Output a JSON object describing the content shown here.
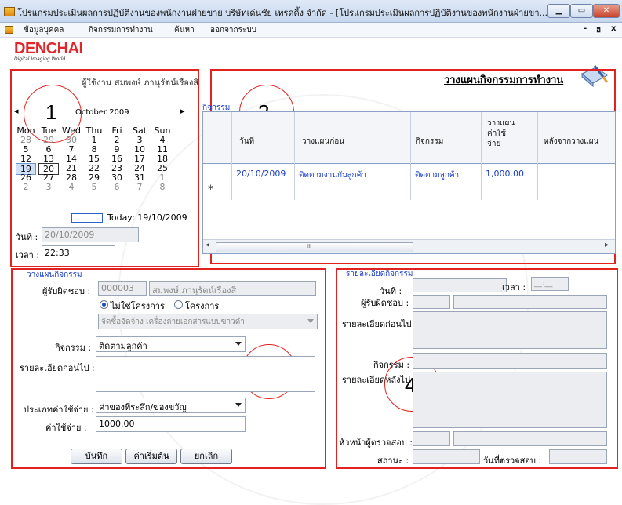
{
  "window": {
    "title": "โปรแกรมประเมินผลการปฏิบัติงานของพนักงานฝ่ายขาย บริษัทเด่นชัย เทรดดิ้ง จำกัด - [โปรแกรมประเมินผลการปฏิบัติงานของพนักงานฝ่ายขา..."
  },
  "menu": {
    "items": [
      "ข้อมูลบุคคล",
      "กิจกรรมการทำงาน",
      "ค้นหา",
      "ออกจากระบบ"
    ],
    "controls": [
      "-",
      "ฮ",
      "x"
    ]
  },
  "header": {
    "logo": "DENCHAI",
    "logo_sub": "Digital Imaging World",
    "user_label": "ผู้ใช้งาน",
    "user_name": "สมพงษ์ ภานุรัตน์เรืองสิ",
    "heading": "วางแผนกิจกรรมการทำงาน"
  },
  "annotations": [
    "1",
    "2",
    "3",
    "4"
  ],
  "calendar": {
    "prev": "◂",
    "next": "▸",
    "month": "October 2009",
    "weekdays": [
      "Mon",
      "Tue",
      "Wed",
      "Thu",
      "Fri",
      "Sat",
      "Sun"
    ],
    "weeks": [
      [
        "28",
        "29",
        "30",
        "1",
        "2",
        "3",
        "4"
      ],
      [
        "5",
        "6",
        "7",
        "8",
        "9",
        "10",
        "11"
      ],
      [
        "12",
        "13",
        "14",
        "15",
        "16",
        "17",
        "18"
      ],
      [
        "19",
        "20",
        "21",
        "22",
        "23",
        "24",
        "25"
      ],
      [
        "26",
        "27",
        "28",
        "29",
        "30",
        "31",
        "1"
      ],
      [
        "2",
        "3",
        "4",
        "5",
        "6",
        "7",
        "8"
      ]
    ],
    "today": "Today: 19/10/2009",
    "date_label": "วันที่ :",
    "date_value": "20/10/2009",
    "time_label": "เวลา :",
    "time_value": "22:33"
  },
  "activity": {
    "group_label": "กิจกรรม",
    "columns": [
      "วันที่",
      "วางแผนก่อน",
      "กิจกรรม",
      "วางแผนค่าใช้จ่าย",
      "หลังจากวางแผน"
    ],
    "rows": [
      [
        "20/10/2009",
        "ติดตามงานกับลูกค้า",
        "ติดตามลูกค้า",
        "1,000.00",
        ""
      ]
    ],
    "new_row_marker": "*",
    "scroll_left": "◂",
    "scroll_right": "▸",
    "scroll_grip": "III"
  },
  "plan": {
    "group_label": "วางแผนกิจกรรม",
    "responsible_label": "ผู้รับผิดชอบ :",
    "responsible_code": "000003",
    "responsible_name": "สมพงษ์ ภานุรัตน์เรืองสิ",
    "radio_no_project": "ไม่ใช่โครงการ",
    "radio_project": "โครงการ",
    "project_placeholder": "จัดซื้อจัดจ้าง เครื่องถ่ายเอกสารแบบขาวดำ",
    "activity_label": "กิจกรรม :",
    "activity_value": "ติดตามลูกค้า",
    "detail_before_label": "รายละเอียดก่อนไป :",
    "expense_type_label": "ประเภทค่าใช้จ่าย :",
    "expense_type_value": "ค่าของที่ระลึก/ของขวัญ",
    "expense_label": "ค่าใช้จ่าย :",
    "expense_value": "1000.00",
    "btn_save": "บันทึก",
    "btn_default": "ค่าเริ่มต้น",
    "btn_cancel": "ยกเลิก"
  },
  "detail": {
    "group_label": "รายละเอียดกิจกรรม",
    "date_label": "วันที่ :",
    "time_label": "เวลา :",
    "time_value": "__:__",
    "responsible_label": "ผู้รับผิดชอบ :",
    "before_label": "รายละเอียดก่อนไป :",
    "activity_label": "กิจกรรม :",
    "after_label": "รายละเอียดหลังไป :",
    "supervisor_label": "หัวหน้าผู้ตรวจสอบ :",
    "status_label": "สถานะ :",
    "check_date_label": "วันที่ตรวจสอบ :"
  }
}
